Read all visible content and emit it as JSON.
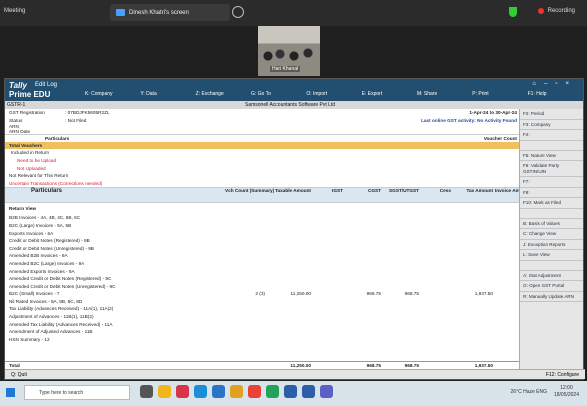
{
  "meeting": {
    "title": "Meeting",
    "share_label": "Dinesh Khatri's screen",
    "recording_label": "Recording"
  },
  "video": {
    "name": "Hari Khanal"
  },
  "tally": {
    "logo": "Tally",
    "edit_label": "Edit Log",
    "product": "Prime EDU",
    "menu": [
      "K: Company",
      "Y: Data",
      "Z: Exchange",
      "G: Go To",
      "O: Import",
      "E: Export",
      "M: Share",
      "P: Print",
      "F1: Help"
    ],
    "strip_left": "GSTR-1",
    "strip_center": "Samsonell Accountants Software Pvt Ltd"
  },
  "report": {
    "gst_reg_label": "GST Registration",
    "gst_reg_value": ": 07BDJFK5605R2ZL",
    "status_label": "Status",
    "status_value": ": Not Filed",
    "arn_label": "ARN",
    "arn_date_label": "ARN Date",
    "period": "1-Apr-24 to 30-Apr-24",
    "last_activity": "Last online GST activity: No Activity Found",
    "particulars_label": "Particulars",
    "voucher_count_label": "Voucher Count",
    "total_vouchers": "Total Vouchers",
    "included_in_return": "Included in Return",
    "need_upload": "Need to be Upload",
    "not_uploaded": "Not Uploaded",
    "not_relevant": "Not Relevant for This Return",
    "uncertain": "Uncertain Transactions (Corrections needed)",
    "columns": [
      "Particulars",
      "Vch Count (Summary)",
      "Taxable Amount",
      "IGST",
      "CGST",
      "SGST/UTGST",
      "Cess",
      "Tax Amount",
      "Invoice Amount"
    ],
    "return_view_label": "Return View",
    "rows": [
      {
        "p": "B2B Invoices - 4A, 4B, 4C, 6B, 6C",
        "v": "",
        "t": "",
        "i": "",
        "c": "",
        "s": "",
        "ce": "",
        "ta": "",
        "ia": ""
      },
      {
        "p": "B2C (Large) Invoices - 5A, 5B",
        "v": "",
        "t": "",
        "i": "",
        "c": "",
        "s": "",
        "ce": "",
        "ta": "",
        "ia": ""
      },
      {
        "p": "Exports Invoices - 6A",
        "v": "",
        "t": "",
        "i": "",
        "c": "",
        "s": "",
        "ce": "",
        "ta": "",
        "ia": ""
      },
      {
        "p": "Credit or Debit Notes (Registered) - 9B",
        "v": "",
        "t": "",
        "i": "",
        "c": "",
        "s": "",
        "ce": "",
        "ta": "",
        "ia": ""
      },
      {
        "p": "Credit or Debit Notes (Unregistered) - 9B",
        "v": "",
        "t": "",
        "i": "",
        "c": "",
        "s": "",
        "ce": "",
        "ta": "",
        "ia": ""
      },
      {
        "p": "Amended B2B Invoices - 9A",
        "v": "",
        "t": "",
        "i": "",
        "c": "",
        "s": "",
        "ce": "",
        "ta": "",
        "ia": ""
      },
      {
        "p": "Amended B2C (Large) Invoices - 9A",
        "v": "",
        "t": "",
        "i": "",
        "c": "",
        "s": "",
        "ce": "",
        "ta": "",
        "ia": ""
      },
      {
        "p": "Amended Exports Invoices - 9A",
        "v": "",
        "t": "",
        "i": "",
        "c": "",
        "s": "",
        "ce": "",
        "ta": "",
        "ia": ""
      },
      {
        "p": "Amended Credit or Debit Notes (Registered) - 9C",
        "v": "",
        "t": "",
        "i": "",
        "c": "",
        "s": "",
        "ce": "",
        "ta": "",
        "ia": ""
      },
      {
        "p": "Amended Credit or Debit Notes (Unregistered) - 9C",
        "v": "",
        "t": "",
        "i": "",
        "c": "",
        "s": "",
        "ce": "",
        "ta": "",
        "ia": ""
      },
      {
        "p": "B2C (Small) Invoices - 7",
        "v": "2   (3)",
        "t": "11,250.00",
        "i": "",
        "c": "968.75",
        "s": "968.75",
        "ce": "",
        "ta": "1,937.50",
        "ia": ""
      },
      {
        "p": "Nil Rated Invoices - 8A, 8B, 8C, 8D",
        "v": "",
        "t": "",
        "i": "",
        "c": "",
        "s": "",
        "ce": "",
        "ta": "",
        "ia": ""
      },
      {
        "p": "Tax Liability (Advances Received) - 11A(1), 11A(2)",
        "v": "",
        "t": "",
        "i": "",
        "c": "",
        "s": "",
        "ce": "",
        "ta": "",
        "ia": ""
      },
      {
        "p": "Adjustment of Advances - 11B(1), 11B(2)",
        "v": "",
        "t": "",
        "i": "",
        "c": "",
        "s": "",
        "ce": "",
        "ta": "",
        "ia": ""
      },
      {
        "p": "Amended Tax Liability (Advances Received) - 11A",
        "v": "",
        "t": "",
        "i": "",
        "c": "",
        "s": "",
        "ce": "",
        "ta": "",
        "ia": ""
      },
      {
        "p": "Amendment of Adjusted Advances - 11B",
        "v": "",
        "t": "",
        "i": "",
        "c": "",
        "s": "",
        "ce": "",
        "ta": "",
        "ia": ""
      },
      {
        "p": "HSN Summary - 12",
        "v": "",
        "t": "",
        "i": "",
        "c": "",
        "s": "",
        "ce": "",
        "ta": "",
        "ia": ""
      }
    ],
    "total_label": "Total",
    "total": {
      "t": "11,250.00",
      "c": "968.75",
      "s": "968.75",
      "ta": "1,937.50"
    },
    "quit_label": "Q: Quit",
    "configure_label": "F12: Configure"
  },
  "sidebar": [
    "F2: Period",
    "F3: Company",
    "F4:",
    "",
    "F5: Nature View",
    "F6: Validate Party GSTIN/UIN",
    "F7:",
    "F8:",
    "F10: Mark as Filed",
    "",
    "B: Basis of Values",
    "C: Change View",
    "J: Exception Reports",
    "L: Save View",
    "",
    "A: Stat Adjustment",
    "O: Open GST Portal",
    "R: Manually Update ARN"
  ],
  "taskbar": {
    "search_placeholder": "Type here to search",
    "weather": "26°C Haze",
    "lang": "ENG",
    "time": "12:00",
    "date": "18/05/2024"
  },
  "colors": {
    "tally_header": "#224f6f",
    "highlight": "#f0c060"
  }
}
